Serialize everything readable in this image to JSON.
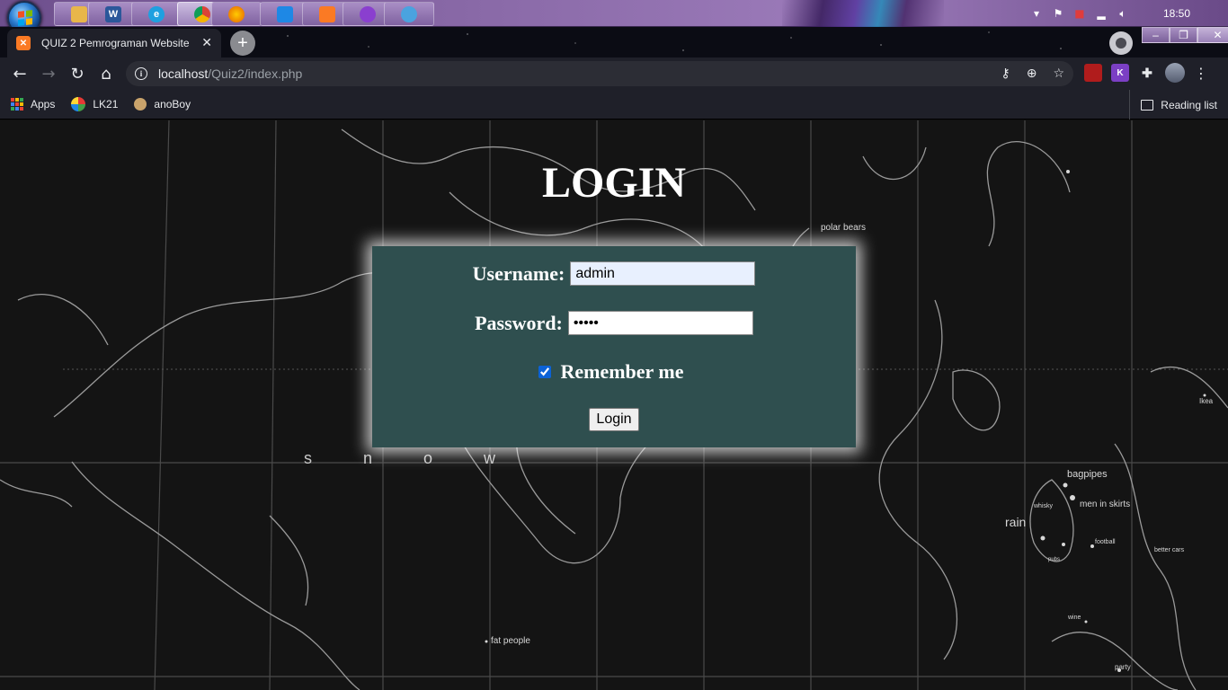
{
  "taskbar": {
    "clock": "18:50",
    "buttons": [
      {
        "name": "file-explorer",
        "label": "",
        "color": "#e8b64a"
      },
      {
        "name": "word",
        "label": "W",
        "color": "#2b579a"
      },
      {
        "name": "internet-explorer",
        "label": "e",
        "color": "#1ea0e0"
      },
      {
        "name": "chrome",
        "label": "",
        "color": "#e8e8e8"
      },
      {
        "name": "firefox",
        "label": "",
        "color": "#e66000"
      },
      {
        "name": "vscode",
        "label": "",
        "color": "#1e88e5"
      },
      {
        "name": "xampp",
        "label": "",
        "color": "#fb7a24"
      },
      {
        "name": "app-purple",
        "label": "",
        "color": "#8a3fcf"
      },
      {
        "name": "paint",
        "label": "",
        "color": "#4aa3df"
      }
    ]
  },
  "browser": {
    "tab_title": "QUIZ 2 Pemrograman Website",
    "tab_close": "✕",
    "new_tab": "+",
    "window_controls": {
      "minimize": "–",
      "maximize": "❐",
      "close": "✕"
    },
    "url_host": "localhost",
    "url_path": "/Quiz2/index.php",
    "bookmarks": [
      {
        "label": "Apps",
        "icon": "apps-grid-icon"
      },
      {
        "label": "LK21",
        "icon": "lk21-icon"
      },
      {
        "label": "anoBoy",
        "icon": "anoboy-icon"
      }
    ],
    "reading_list": "Reading list"
  },
  "background_map": {
    "labels": [
      "polar bears",
      "s n o w",
      "bagpipes",
      "whisky",
      "men in skirts",
      "rain",
      "football",
      "better cars",
      "wine",
      "party",
      "fat people",
      "Ikea",
      "pubs"
    ]
  },
  "login": {
    "title": "LOGIN",
    "username_label": "Username:",
    "username_value": "admin",
    "password_label": "Password:",
    "password_value": "admin",
    "remember_label": "Remember me",
    "remember_checked": true,
    "submit_label": "Login",
    "box_color": "#2f4f4f"
  }
}
